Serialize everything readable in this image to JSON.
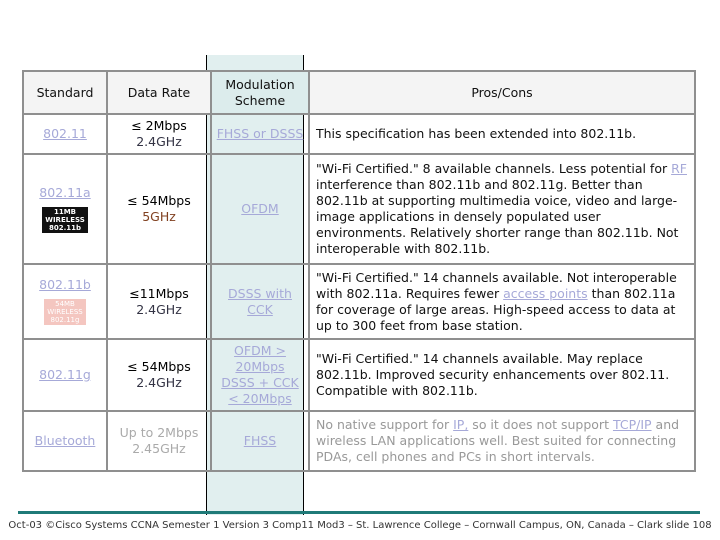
{
  "headers": {
    "standard": "Standard",
    "rate": "Data Rate",
    "mod": "Modulation Scheme",
    "pros": "Pros/Cons"
  },
  "rows": [
    {
      "standard": "802.11",
      "rate1": "≤ 2Mbps",
      "rate2": "2.4GHz",
      "mod": "FHSS or DSSS",
      "pros": "This specification has been extended into 802.11b."
    },
    {
      "standard": "802.11a",
      "rate1": "≤ 54Mbps",
      "rate2": "5GHz",
      "mod": "OFDM",
      "pros_a": "\"Wi-Fi Certified.\" 8 available channels. Less potential for ",
      "pros_link": "RF",
      "pros_b": " interference than 802.11b and 802.11g. Better than 802.11b at supporting multimedia voice, video and large-image applications in densely populated user environments. Relatively shorter range than 802.11b. Not interoperable with 802.11b.",
      "badge": "11MB WIRELESS 802.11b"
    },
    {
      "standard": "802.11b",
      "rate1": "≤11Mbps",
      "rate2": "2.4GHz",
      "mod": "DSSS with CCK",
      "pros_a": "\"Wi-Fi Certified.\" 14 channels available. Not interoperable with 802.11a. Requires fewer ",
      "pros_link": "access points",
      "pros_b": " than 802.11a for coverage of large areas. High-speed access to data at up to 300 feet from base station.",
      "badge": "54MB WIRELESS 802.11g"
    },
    {
      "standard": "802.11g",
      "rate1": "≤ 54Mbps",
      "rate2": "2.4GHz",
      "mod1": "OFDM >",
      "mod2": "20Mbps",
      "mod3": "DSSS + CCK",
      "mod4": "< 20Mbps",
      "pros": "\"Wi-Fi Certified.\" 14 channels available. May replace 802.11b. Improved security enhancements over 802.11. Compatible with 802.11b."
    },
    {
      "standard": "Bluetooth",
      "rate1": "Up to 2Mbps",
      "rate2": "2.45GHz",
      "mod": "FHSS",
      "pros_a": "No native support for ",
      "pros_link1": "IP,",
      "pros_b": " so it does not support ",
      "pros_link2": "TCP/IP",
      "pros_c": " and wireless LAN applications well. Best suited for connecting PDAs, cell phones and PCs in short intervals."
    }
  ],
  "footer": "Oct-03 ©Cisco Systems CCNA Semester 1 Version 3 Comp11 Mod3 – St. Lawrence College – Cornwall Campus, ON, Canada – Clark slide 108",
  "colors": {
    "accent": "#1f7a78",
    "highlight": "#e1efef"
  }
}
